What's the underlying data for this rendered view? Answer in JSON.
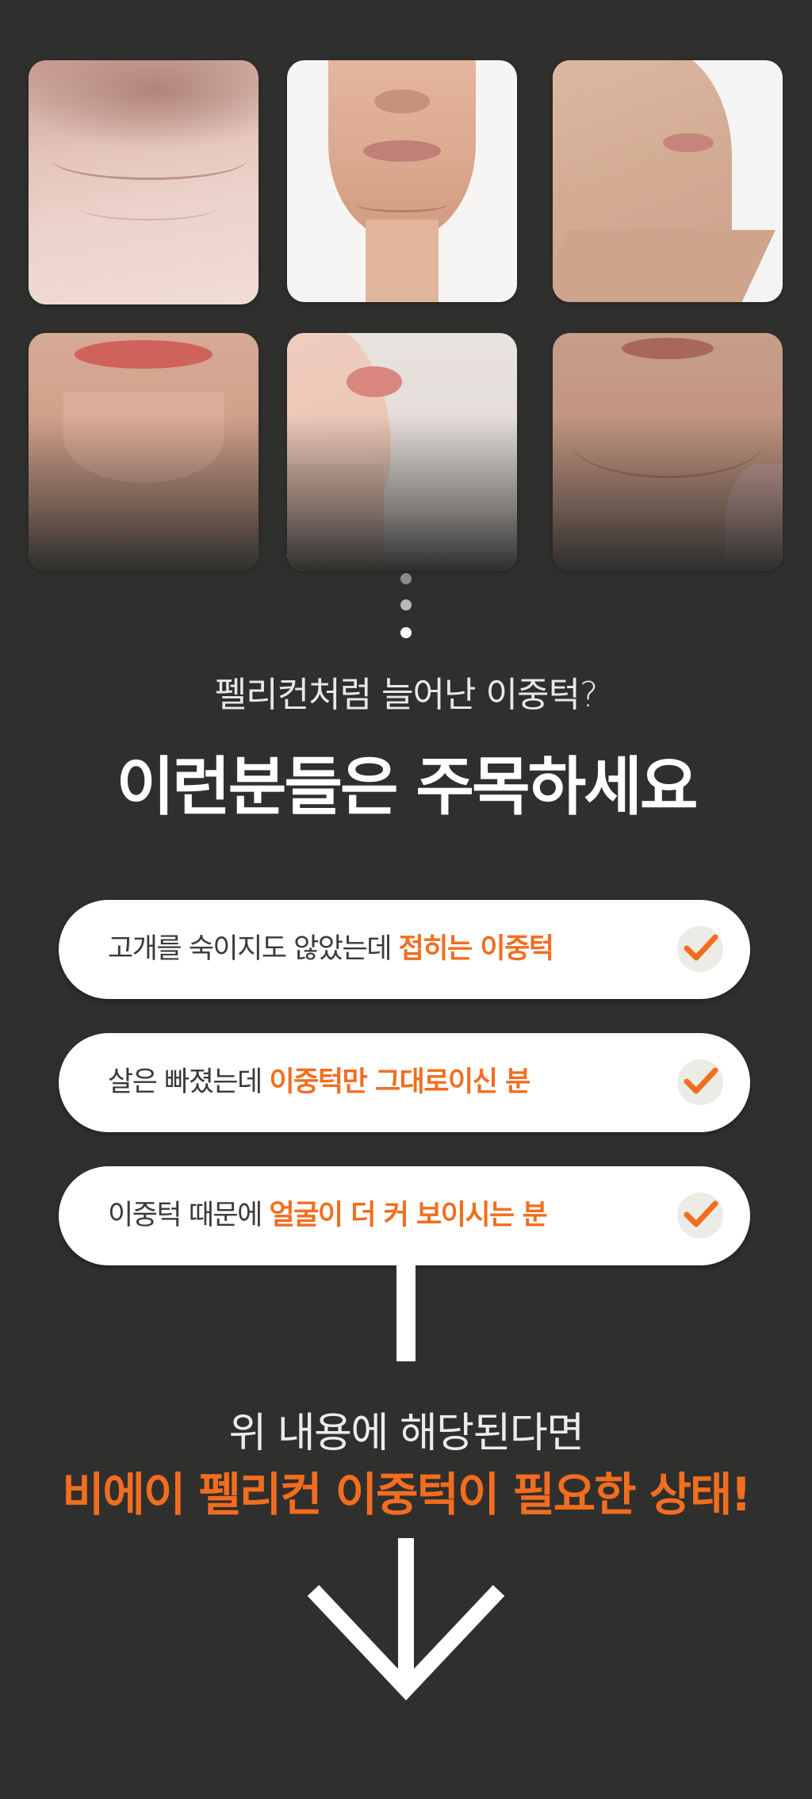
{
  "photos": [
    {
      "name": "neck-photo",
      "desc": "neck close-up"
    },
    {
      "name": "double-chin-front-photo",
      "desc": "double chin front"
    },
    {
      "name": "jawline-profile-photo",
      "desc": "jawline profile"
    },
    {
      "name": "lips-chin-photo",
      "desc": "lips and chin"
    },
    {
      "name": "lips-profile-photo",
      "desc": "lips profile"
    },
    {
      "name": "sagging-jaw-photo",
      "desc": "sagging jaw"
    }
  ],
  "headline": {
    "subtitle": "펠리컨처럼 늘어난 이중턱?",
    "title": "이런분들은 주목하세요"
  },
  "checklist": [
    {
      "plain": "고개를 숙이지도 않았는데 ",
      "highlight": "접히는 이중턱"
    },
    {
      "plain": "살은 빠졌는데 ",
      "highlight": "이중턱만 그대로이신 분"
    },
    {
      "plain": "이중턱 때문에 ",
      "highlight": "얼굴이 더 커 보이시는 분"
    }
  ],
  "outro": {
    "line1": "위 내용에 해당된다면",
    "line2": "비에이 펠리컨 이중턱이 필요한 상태!"
  },
  "colors": {
    "background": "#2f2f2e",
    "accent": "#f26d1f",
    "pill": "#ffffff"
  },
  "icons": {
    "check": "check-icon",
    "arrow": "arrow-down-icon"
  }
}
